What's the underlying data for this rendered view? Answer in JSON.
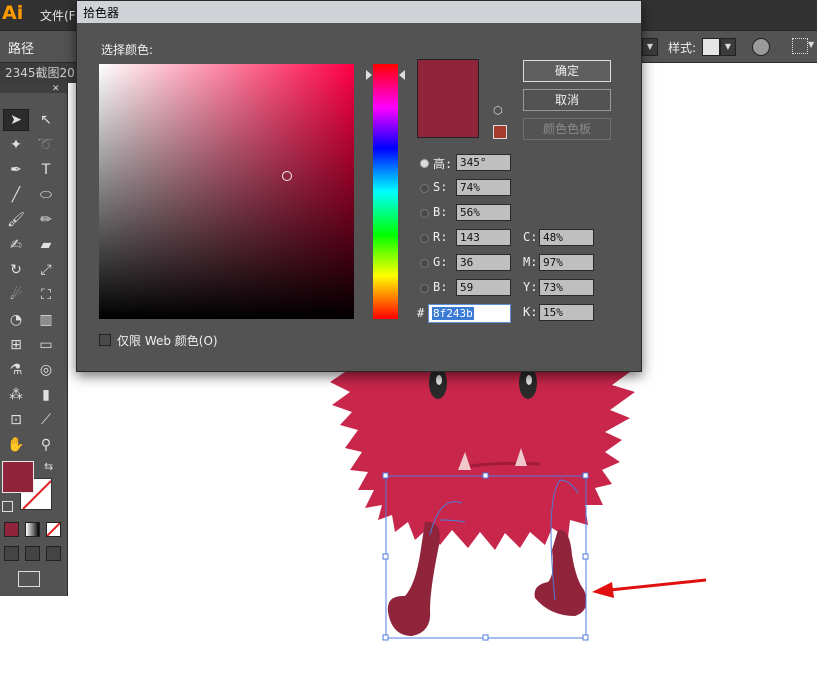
{
  "app": {
    "logo": "Ai",
    "menu_file": "文件(F",
    "path_label": "路径",
    "style_label": "样式:",
    "doc_tab": "2345截图20"
  },
  "dialog": {
    "title": "拾色器",
    "select_label": "选择颜色:",
    "ok_label": "确定",
    "cancel_label": "取消",
    "swatches_label": "颜色色板",
    "web_only_label": "仅限 Web 颜色(O)",
    "selected_color": "#8f243b",
    "gamut_color": "#a53a2f",
    "hsb": {
      "h_label": "高:",
      "h": "345°",
      "s_label": "S:",
      "s": "74%",
      "b_label": "B:",
      "b": "56%",
      "active": "h"
    },
    "rgb": {
      "r_label": "R:",
      "r": "143",
      "g_label": "G:",
      "g": "36",
      "b_label": "B:",
      "b": "59"
    },
    "cmyk": {
      "c_label": "C:",
      "c": "48%",
      "m_label": "M:",
      "m": "97%",
      "y_label": "Y:",
      "y": "73%",
      "k_label": "K:",
      "k": "15%"
    },
    "hex_label": "#",
    "hex": "8f243b"
  },
  "icons": [
    "selection-tool-icon",
    "direct-selection-tool-icon",
    "magic-wand-icon",
    "lasso-icon",
    "pen-icon",
    "type-icon",
    "line-icon",
    "ellipse-icon",
    "paintbrush-icon",
    "pencil-icon",
    "blob-brush-icon",
    "eraser-icon",
    "rotate-icon",
    "scale-icon",
    "warp-icon",
    "free-transform-icon",
    "shape-builder-icon",
    "perspective-icon",
    "mesh-icon",
    "gradient-icon",
    "eyedropper-icon",
    "blend-icon",
    "symbol-sprayer-icon",
    "graph-icon",
    "artboard-icon",
    "slice-icon",
    "hand-icon",
    "zoom-icon"
  ],
  "colors": {
    "fill": "#8f243b",
    "monster_body": "#c8264a",
    "monster_legs": "#8f243b",
    "selection": "#4f7bdc",
    "arrow": "#e01010"
  }
}
